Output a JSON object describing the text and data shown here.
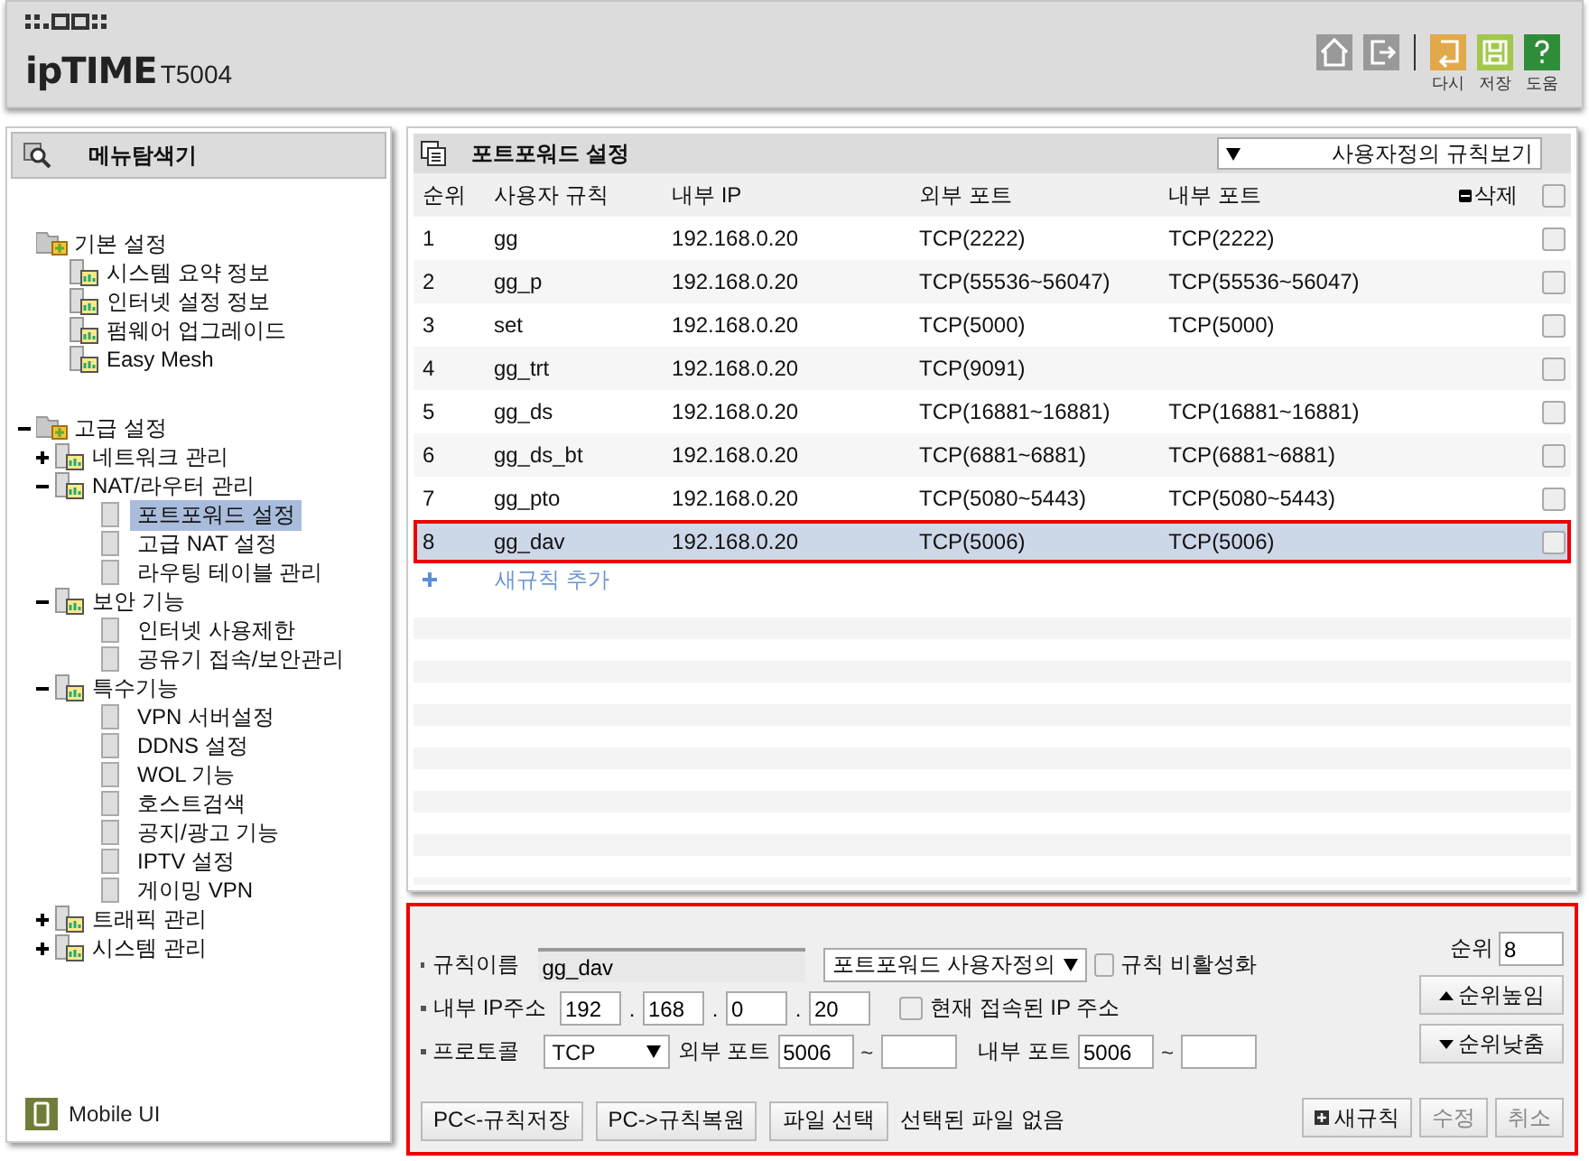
{
  "header": {
    "logo_brand": "ipTIME",
    "logo_model": "T5004",
    "actions": [
      {
        "kind": "home"
      },
      {
        "kind": "logout"
      },
      {
        "kind": "undo",
        "label": "다시"
      },
      {
        "kind": "save",
        "label": "저장"
      },
      {
        "kind": "help",
        "label": "도움"
      }
    ]
  },
  "sidebar": {
    "title": "메뉴탐색기",
    "tree": [
      {
        "label": "기본 설정",
        "children": [
          {
            "label": "시스템 요약 정보"
          },
          {
            "label": "인터넷 설정 정보"
          },
          {
            "label": "펌웨어 업그레이드"
          },
          {
            "label": "Easy Mesh"
          }
        ]
      },
      {
        "label": "고급 설정",
        "expanded": true,
        "children": [
          {
            "label": "네트워크 관리",
            "expanded": false
          },
          {
            "label": "NAT/라우터 관리",
            "expanded": true,
            "children": [
              {
                "label": "포트포워드 설정",
                "selected": true
              },
              {
                "label": "고급 NAT 설정",
                "selected": false
              },
              {
                "label": "라우팅 테이블 관리",
                "selected": false
              }
            ]
          },
          {
            "label": "보안 기능",
            "expanded": true,
            "children": [
              {
                "label": "인터넷 사용제한",
                "selected": false
              },
              {
                "label": "공유기 접속/보안관리",
                "selected": false
              }
            ]
          },
          {
            "label": "특수기능",
            "expanded": true,
            "children": [
              {
                "label": "VPN 서버설정",
                "selected": false
              },
              {
                "label": "DDNS 설정",
                "selected": false
              },
              {
                "label": "WOL 기능",
                "selected": false
              },
              {
                "label": "호스트검색",
                "selected": false
              },
              {
                "label": "공지/광고 기능",
                "selected": false
              },
              {
                "label": "IPTV 설정",
                "selected": false
              },
              {
                "label": "게이밍 VPN",
                "selected": false
              }
            ]
          },
          {
            "label": "트래픽 관리",
            "expanded": false
          },
          {
            "label": "시스템 관리",
            "expanded": false
          }
        ]
      }
    ],
    "footer_link": "Mobile UI"
  },
  "panel": {
    "title": "포트포워드 설정",
    "view_select": "사용자정의 규칙보기",
    "table": {
      "columns": [
        "순위",
        "사용자 규칙",
        "내부 IP",
        "외부 포트",
        "내부 포트",
        "삭제"
      ],
      "select_all_checked": false,
      "rows": [
        {
          "cells": [
            "1",
            "gg",
            "192.168.0.20",
            "TCP(2222)",
            "TCP(2222)"
          ],
          "checked": false,
          "selected": false
        },
        {
          "cells": [
            "2",
            "gg_p",
            "192.168.0.20",
            "TCP(55536~56047)",
            "TCP(55536~56047)"
          ],
          "checked": false,
          "selected": false
        },
        {
          "cells": [
            "3",
            "set",
            "192.168.0.20",
            "TCP(5000)",
            "TCP(5000)"
          ],
          "checked": false,
          "selected": false
        },
        {
          "cells": [
            "4",
            "gg_trt",
            "192.168.0.20",
            "TCP(9091)",
            ""
          ],
          "checked": false,
          "selected": false
        },
        {
          "cells": [
            "5",
            "gg_ds",
            "192.168.0.20",
            "TCP(16881~16881)",
            "TCP(16881~16881)"
          ],
          "checked": false,
          "selected": false
        },
        {
          "cells": [
            "6",
            "gg_ds_bt",
            "192.168.0.20",
            "TCP(6881~6881)",
            "TCP(6881~6881)"
          ],
          "checked": false,
          "selected": false
        },
        {
          "cells": [
            "7",
            "gg_pto",
            "192.168.0.20",
            "TCP(5080~5443)",
            "TCP(5080~5443)"
          ],
          "checked": false,
          "selected": false
        },
        {
          "cells": [
            "8",
            "gg_dav",
            "192.168.0.20",
            "TCP(5006)",
            "TCP(5006)"
          ],
          "checked": false,
          "selected": true
        }
      ],
      "add_rule": "새규칙 추가"
    }
  },
  "form": {
    "rule_name": {
      "label": "규칙이름",
      "value": "gg_dav"
    },
    "preset": "포트포워드 사용자정의",
    "disable_rule": {
      "label": "규칙 비활성화",
      "checked": false
    },
    "internal_ip": {
      "label": "내부 IP주소",
      "octets": [
        "192",
        "168",
        "0",
        "20"
      ],
      "separators": [
        ".",
        ".",
        "."
      ]
    },
    "current_ip": {
      "label": "현재 접속된 IP 주소",
      "checked": false
    },
    "protocol": {
      "label": "프로토콜",
      "value": "TCP"
    },
    "external_port": {
      "label": "외부 포트",
      "from": "5006",
      "separator": "~"
    },
    "internal_port": {
      "label": "내부 포트",
      "from": "5006",
      "separator": "~"
    },
    "order": {
      "label": "순위",
      "value": "8",
      "up": "순위높임",
      "down": "순위낮춤"
    },
    "buttons": [
      {
        "label": "PC<-규칙저장",
        "disabled": false
      },
      {
        "label": "PC->규칙복원",
        "disabled": false
      }
    ],
    "file_button": "파일 선택",
    "file_status": "선택된 파일 없음",
    "new_rule": "새규칙",
    "edit": {
      "label": "수정",
      "disabled": true
    },
    "cancel": {
      "label": "취소",
      "disabled": true
    }
  }
}
